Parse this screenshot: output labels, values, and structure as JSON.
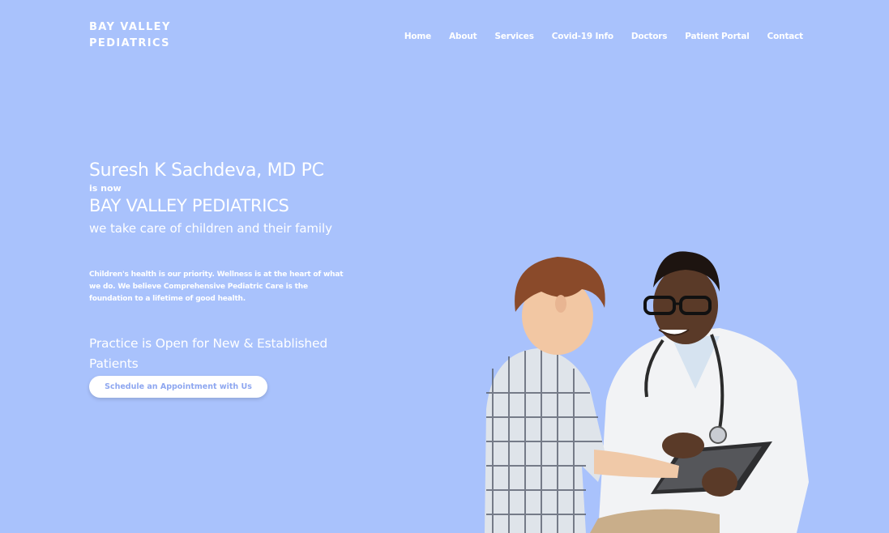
{
  "header": {
    "logo_line1": "BAY VALLEY",
    "logo_line2": "PEDIATRICS",
    "nav": [
      "Home",
      "About",
      "Services",
      "Covid-19 Info",
      "Doctors",
      "Patient Portal",
      "Contact"
    ]
  },
  "hero": {
    "name": "Suresh K Sachdeva, MD PC",
    "is_now": "is now",
    "brand": "BAY VALLEY PEDIATRICS",
    "tagline": "we take care of children and their family",
    "description": "Children's health is our priority. Wellness is at the heart of what we do. We believe Comprehensive Pediatric Care is the foundation to a lifetime of good health.",
    "open_notice": "Practice is Open for New & Established Patients",
    "cta_label": "Schedule an Appointment with Us"
  },
  "colors": {
    "background": "#a9c2fc",
    "text": "#ffffff",
    "cta_text": "#8ea7f0"
  },
  "icons": [
    "doctor-with-child-photo"
  ]
}
